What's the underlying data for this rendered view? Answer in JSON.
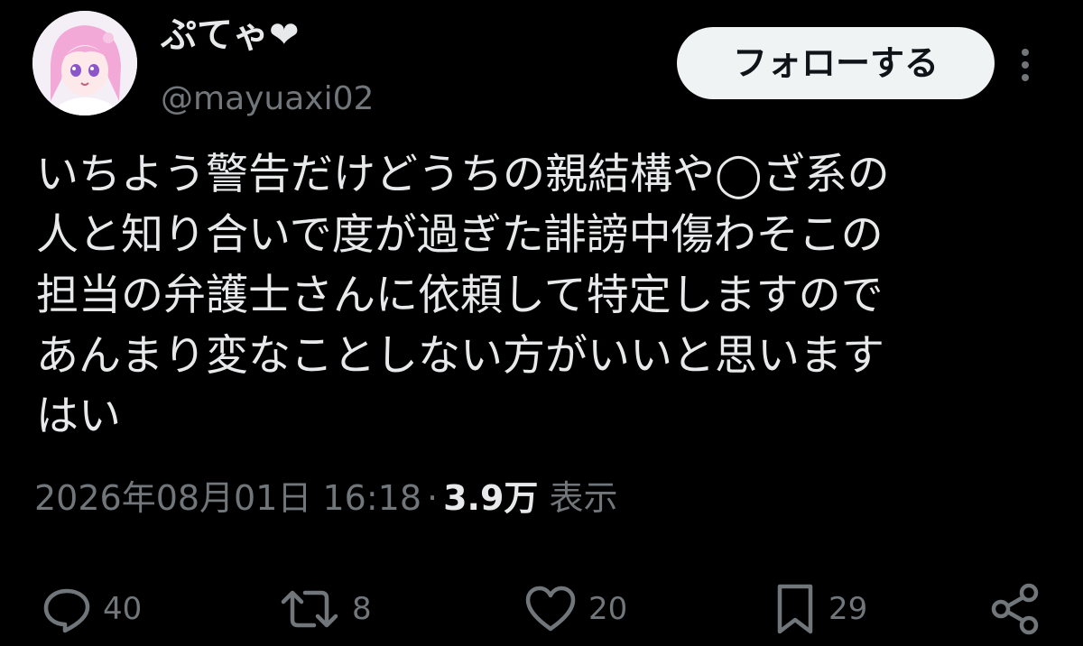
{
  "user": {
    "display_name": "ぷてゃ❤",
    "handle": "@mayuaxi02"
  },
  "follow_button": {
    "label": "フォローする"
  },
  "tweet": {
    "text": "いちよう警告だけどうちの親結構や◯ざ系の\n人と知り合いで度が過ぎた誹謗中傷わそこの\n担当の弁護士さんに依頼して特定しますので\nあんまり変なことしない方がいいと思います\nはい"
  },
  "meta": {
    "timestamp": "2026年08月01日 16:18",
    "separator": "·",
    "views_count": "3.9万",
    "views_label": "表示"
  },
  "actions": {
    "reply": {
      "icon": "reply-icon",
      "count": "40"
    },
    "retweet": {
      "icon": "retweet-icon",
      "count": "8"
    },
    "like": {
      "icon": "heart-icon",
      "count": "20"
    },
    "bookmark": {
      "icon": "bookmark-icon",
      "count": "29"
    },
    "share": {
      "icon": "share-icon"
    }
  },
  "colors": {
    "background": "#000000",
    "primary_text": "#e7e9ea",
    "secondary_text": "#71767b",
    "follow_button_bg": "#eff3f4",
    "follow_button_text": "#0f1419"
  }
}
